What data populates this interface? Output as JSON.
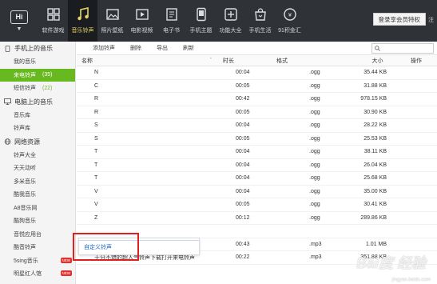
{
  "app": {
    "logo_text": "Hi",
    "vip_button": "登录享会员特权",
    "top_extra": "注"
  },
  "nav": [
    {
      "label": "软件游戏",
      "icon": "grid-icon"
    },
    {
      "label": "音乐铃声",
      "icon": "music-note-icon",
      "active": true
    },
    {
      "label": "照片壁纸",
      "icon": "photo-icon"
    },
    {
      "label": "电影视频",
      "icon": "video-icon"
    },
    {
      "label": "电子书",
      "icon": "ebook-icon"
    },
    {
      "label": "手机主题",
      "icon": "theme-icon"
    },
    {
      "label": "功能大全",
      "icon": "tools-icon"
    },
    {
      "label": "手机生活",
      "icon": "shopping-bag-icon"
    },
    {
      "label": "91积金汇",
      "icon": "coin-icon"
    }
  ],
  "sidebar": {
    "phone_music": {
      "title": "手机上的音乐",
      "items": [
        {
          "label": "我的音乐"
        },
        {
          "label": "来电铃声",
          "count": "(35)",
          "active": true
        },
        {
          "label": "短信铃声",
          "count": "(22)"
        }
      ]
    },
    "pc_music": {
      "title": "电脑上的音乐",
      "items": [
        {
          "label": "音乐库"
        },
        {
          "label": "铃声库"
        }
      ]
    },
    "online": {
      "title": "网络资源",
      "items": [
        {
          "label": "铃声大全"
        },
        {
          "label": "天天动听"
        },
        {
          "label": "多米音乐"
        },
        {
          "label": "酷我音乐"
        },
        {
          "label": "A8音乐网"
        },
        {
          "label": "酷狗音乐"
        },
        {
          "label": "音悦应用台"
        },
        {
          "label": "酷音铃声"
        },
        {
          "label": "5sing音乐",
          "badge": "NEW"
        },
        {
          "label": "明星红人馆",
          "badge": "NEW"
        }
      ]
    }
  },
  "toolbar": {
    "add": "添加铃声",
    "delete": "删除",
    "export": "导出",
    "refresh": "刷新",
    "search_placeholder": ""
  },
  "table": {
    "headers": {
      "name": "名称",
      "sort": "-",
      "time": "时长",
      "format": "格式",
      "size": "大小",
      "op": "操作"
    },
    "rows": [
      {
        "name": "N",
        "time": "00:04",
        "format": ".ogg",
        "size": "35.44 KB"
      },
      {
        "name": "C",
        "time": "00:05",
        "format": ".ogg",
        "size": "31.88 KB"
      },
      {
        "name": "R",
        "time": "00:42",
        "format": ".ogg",
        "size": "978.15 KB"
      },
      {
        "name": "R",
        "time": "00:05",
        "format": ".ogg",
        "size": "30.90 KB"
      },
      {
        "name": "S",
        "time": "00:04",
        "format": ".ogg",
        "size": "28.22 KB"
      },
      {
        "name": "S",
        "time": "00:05",
        "format": ".ogg",
        "size": "25.53 KB"
      },
      {
        "name": "T",
        "time": "00:04",
        "format": ".ogg",
        "size": "38.11 KB"
      },
      {
        "name": "T",
        "time": "00:04",
        "format": ".ogg",
        "size": "26.04 KB"
      },
      {
        "name": "T",
        "time": "00:04",
        "format": ".ogg",
        "size": "25.68 KB"
      },
      {
        "name": "V",
        "time": "00:04",
        "format": ".ogg",
        "size": "35.00 KB"
      },
      {
        "name": "V",
        "time": "00:05",
        "format": ".ogg",
        "size": "30.41 KB"
      },
      {
        "name": "Z",
        "time": "00:12",
        "format": ".ogg",
        "size": "289.86 KB"
      },
      {
        "name": "",
        "time": "",
        "format": "",
        "size": ""
      },
      {
        "name": "",
        "time": "00:43",
        "format": ".mp3",
        "size": "1.01 MB"
      },
      {
        "name": "十分不错的超人气铃声下载打开来电铃声",
        "time": "00:22",
        "format": ".mp3",
        "size": "351.88 KB"
      }
    ]
  },
  "popup": {
    "item": "自定义铃声"
  },
  "watermark": {
    "brand": "Bai度 经验",
    "sub": "jingyan.baidu.com"
  }
}
